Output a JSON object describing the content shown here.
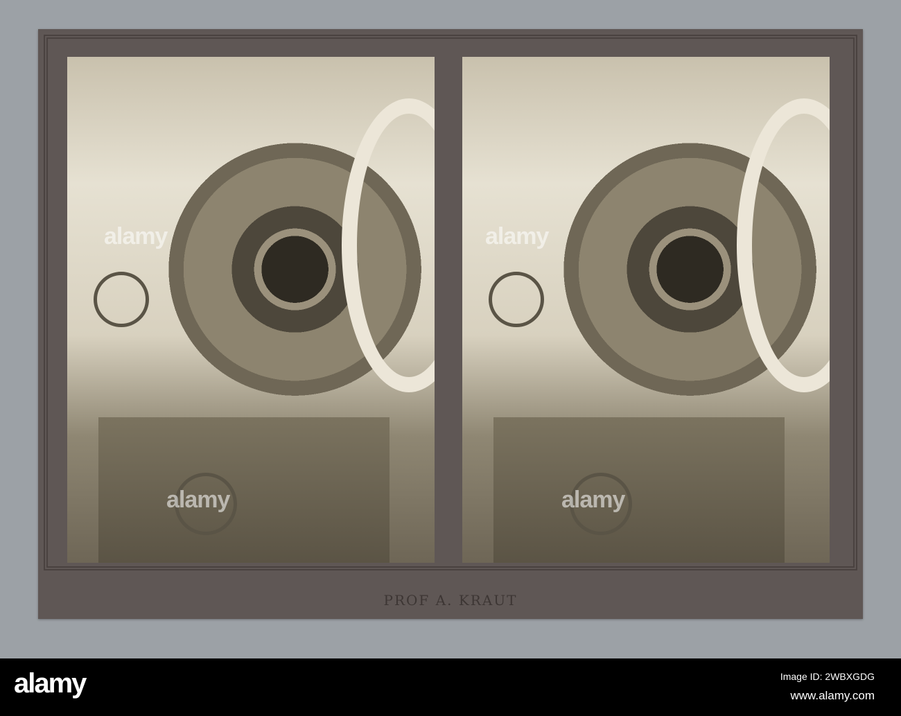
{
  "card": {
    "imprint": "PROF A. KRAUT"
  },
  "watermark": "alamy",
  "footer": {
    "logo": "alamy",
    "image_id": "Image ID: 2WBXGDG",
    "url": "www.alamy.com"
  }
}
